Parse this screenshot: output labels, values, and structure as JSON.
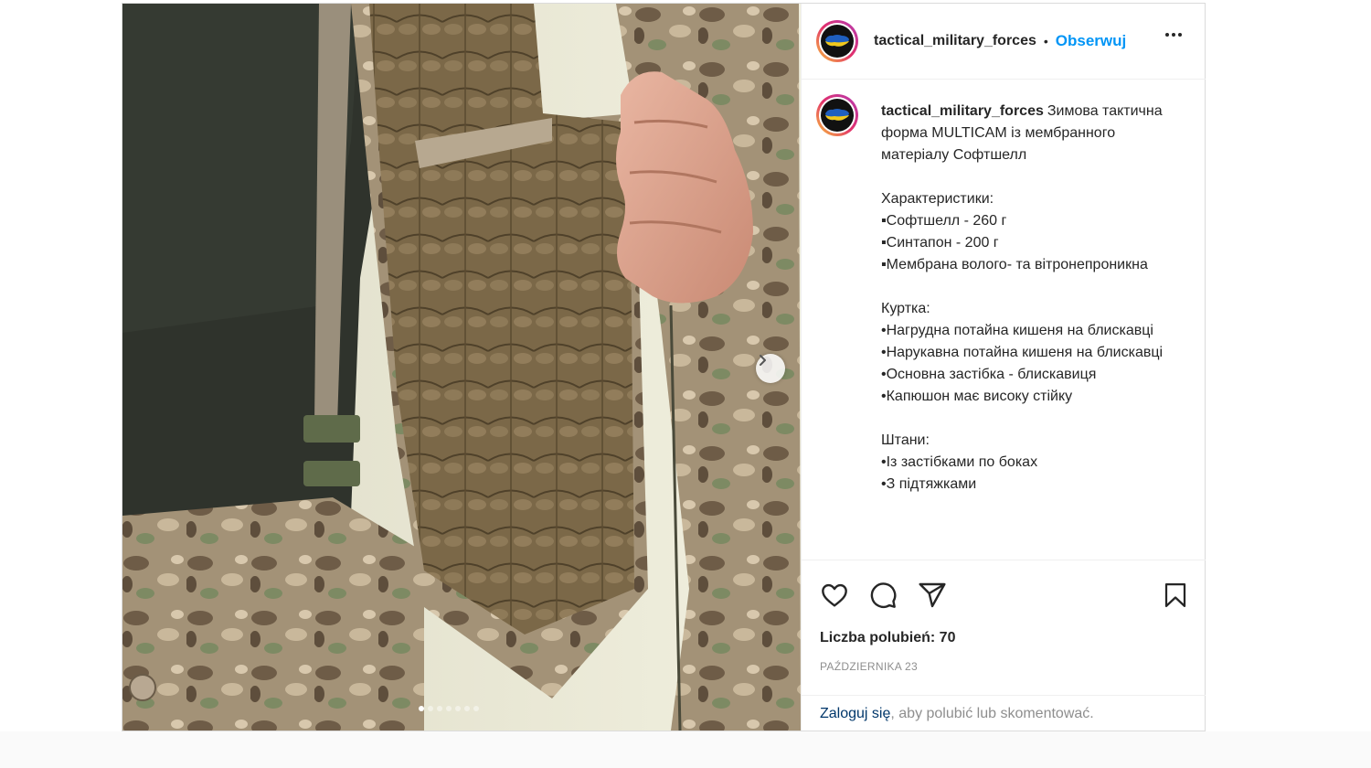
{
  "post": {
    "username": "tactical_military_forces",
    "separator": "•",
    "follow_label": "Obserwuj",
    "caption_username": "tactical_military_forces",
    "caption_text": "Зимова тактична форма MULTICAM із мембранного матеріалу Софтшелл\n\nХарактеристики:\n▪Софтшелл - 260 г\n▪Синтапон - 200 г\n▪Мембрана волого- та вітронепроникна\n\nКуртка:\n•Нагрудна потайна кишеня на блискавці\n•Нарукавна потайна кишеня на блискавці\n•Основна застібка - блискавиця\n•Капюшон має високу стійку\n\nШтани:\n•Із застібками по боках\n•З підтяжками",
    "likes_label": "Liczba polubień: 70",
    "date_label": "PAŹDZIERNIKA 23",
    "login_link": "Zaloguj się",
    "login_rest": ", aby polubić lub skomentować."
  },
  "carousel": {
    "total_slides": 7,
    "active_slide": 1
  },
  "icons": {
    "like": "heart-icon",
    "comment": "comment-icon",
    "share": "share-icon",
    "save": "bookmark-icon",
    "next": "chevron-right-icon",
    "more": "more-icon"
  },
  "colors": {
    "accent": "#0095f6",
    "text": "#262626",
    "muted": "#8e8e8e",
    "link": "#00376b"
  }
}
